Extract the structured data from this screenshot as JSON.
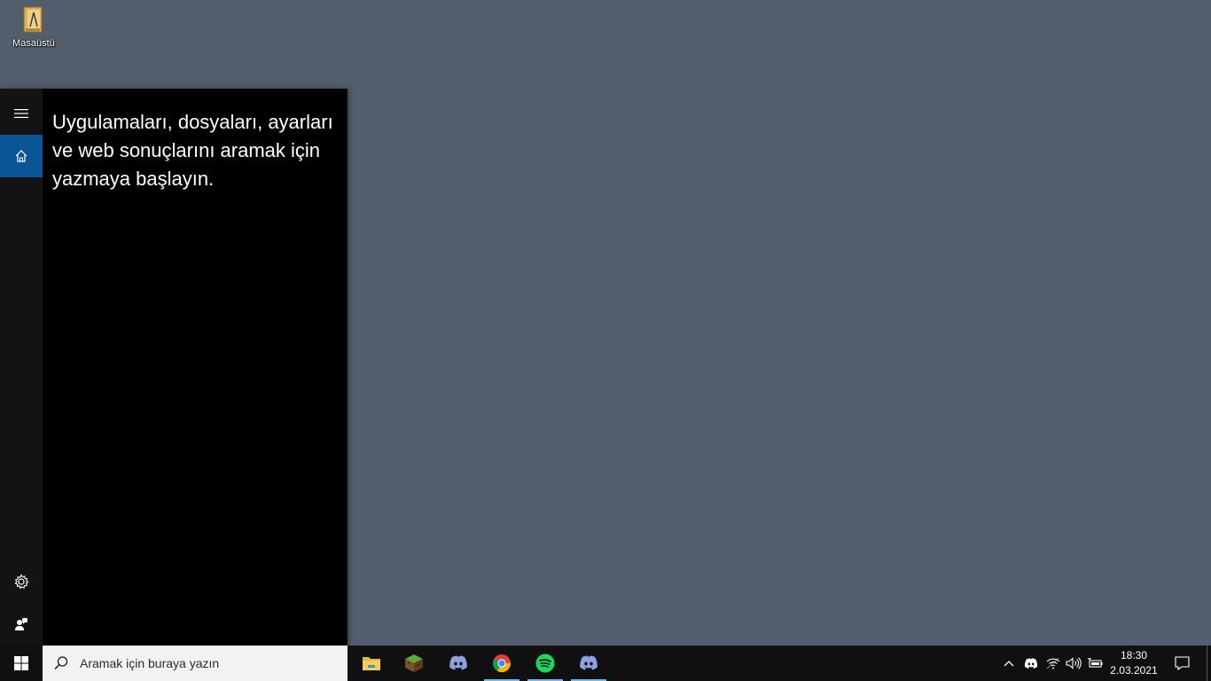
{
  "desktop": {
    "icon_label": "Masaüstü"
  },
  "search_panel": {
    "hint_text": "Uygulamaları, dosyaları, ayarları ve web sonuçlarını aramak için yazmaya başlayın.",
    "rail": {
      "menu_icon": "hamburger-icon",
      "home_icon": "home-icon",
      "settings_icon": "gear-icon",
      "feedback_icon": "feedback-icon"
    },
    "accent": "#0a5496"
  },
  "taskbar": {
    "search_placeholder": "Aramak için buraya yazın",
    "apps": [
      {
        "name": "file-explorer",
        "running": false
      },
      {
        "name": "minecraft",
        "running": false
      },
      {
        "name": "discord",
        "running": false
      },
      {
        "name": "chrome",
        "running": true
      },
      {
        "name": "spotify",
        "running": true
      },
      {
        "name": "discord",
        "running": true
      }
    ],
    "clock": {
      "time": "18:30",
      "date": "2.03.2021"
    }
  }
}
